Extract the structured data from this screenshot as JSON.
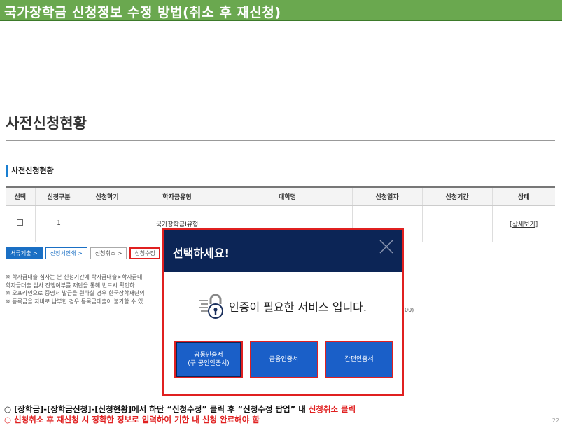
{
  "slide": {
    "title": "국가장학금 신청정보 수정 방법(취소 후 재신청)",
    "page_number": "22"
  },
  "page": {
    "heading": "사전신청현황",
    "section_title": "사전신청현황"
  },
  "table": {
    "headers": [
      "선택",
      "신청구분",
      "신청학기",
      "학자금유형",
      "대학명",
      "신청일자",
      "신청기간",
      "상태"
    ],
    "row": {
      "checkbox": "□",
      "type": "1",
      "semester": "",
      "aid_type": "국가장학금I유형",
      "university": "",
      "date": "",
      "period": "",
      "status": "[상세보기]"
    }
  },
  "buttons": {
    "submit_docs": "서류제출 >",
    "print_app": "신청서인쇄 >",
    "cancel_app": "신청취소 >",
    "edit_app": "신청수정"
  },
  "notes": [
    "※ 학자금대출 심사는 본 신청기간에 학자금대출>학자금대",
    "학자금대출 심사 진행여부를 재단을 통해 반드시 확인하",
    "※ 오프라인으로 증명서 발급을 원하실 경우 한국장학재단의",
    "※ 등록금을 자비로 납부한 경우 등록금대출이 불가할 수 있"
  ],
  "note_tail": "00)",
  "modal": {
    "title": "선택하세요!",
    "message": "인증이 필요한 서비스 입니다.",
    "btn_joint_line1": "공동인증서",
    "btn_joint_line2": "(구 공인인증서)",
    "btn_financial": "금융인증서",
    "btn_simple": "간편인증서"
  },
  "captions": {
    "line1_prefix": "○ [장학금]-[장학금신청]-[신청현황]에서 하단 “신청수정” 클릭 후 “신청수정 팝업” 내 ",
    "line1_red": "신청취소 클릭",
    "line2": "○ 신청취소 후 재신청 시 정확한 정보로 입력하여 기한 내 신청 완료해야 함"
  },
  "colors": {
    "title_bar": "#6aa84f",
    "modal_header": "#0c2556",
    "modal_button": "#1a5fc8",
    "highlight": "#e02020"
  }
}
